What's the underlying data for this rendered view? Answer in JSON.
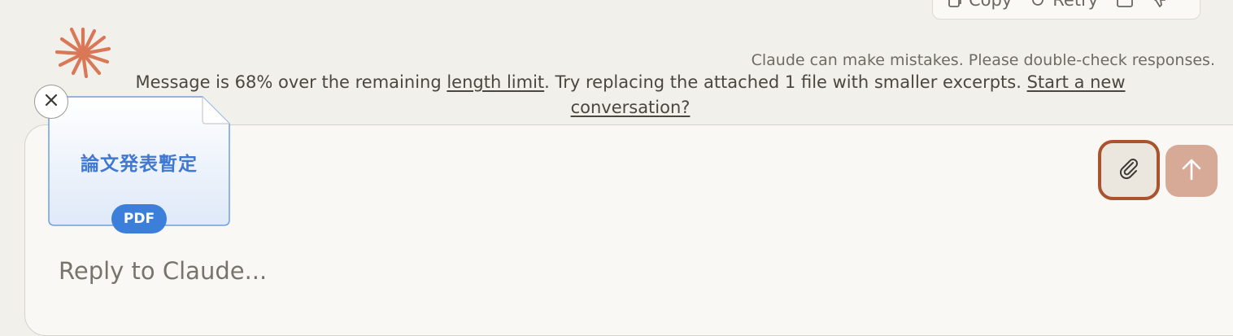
{
  "action_bar": {
    "copy_label": "Copy",
    "retry_label": "Retry",
    "icons": [
      "copy-icon",
      "retry-icon",
      "share-icon",
      "thumbs-down-icon"
    ]
  },
  "logo": {
    "name": "claude-logo",
    "color": "#d97757"
  },
  "disclaimer": "Claude can make mistakes. Please double-check responses.",
  "warning": {
    "prefix": "Message is 68% over the remaining ",
    "length_limit_link": "length limit",
    "middle": ". Try replacing the attached 1 file with smaller excerpts. ",
    "new_conversation_link_1": "Start a new",
    "new_conversation_link_2": "conversation?"
  },
  "attachment": {
    "title": "論文発表暫定",
    "badge": "PDF",
    "accent": "#3b7fdb"
  },
  "composer": {
    "placeholder": "Reply to Claude..."
  },
  "colors": {
    "background": "#f2f0eb",
    "send_button": "#d7aa98",
    "attach_focus_ring": "#a9532f"
  }
}
